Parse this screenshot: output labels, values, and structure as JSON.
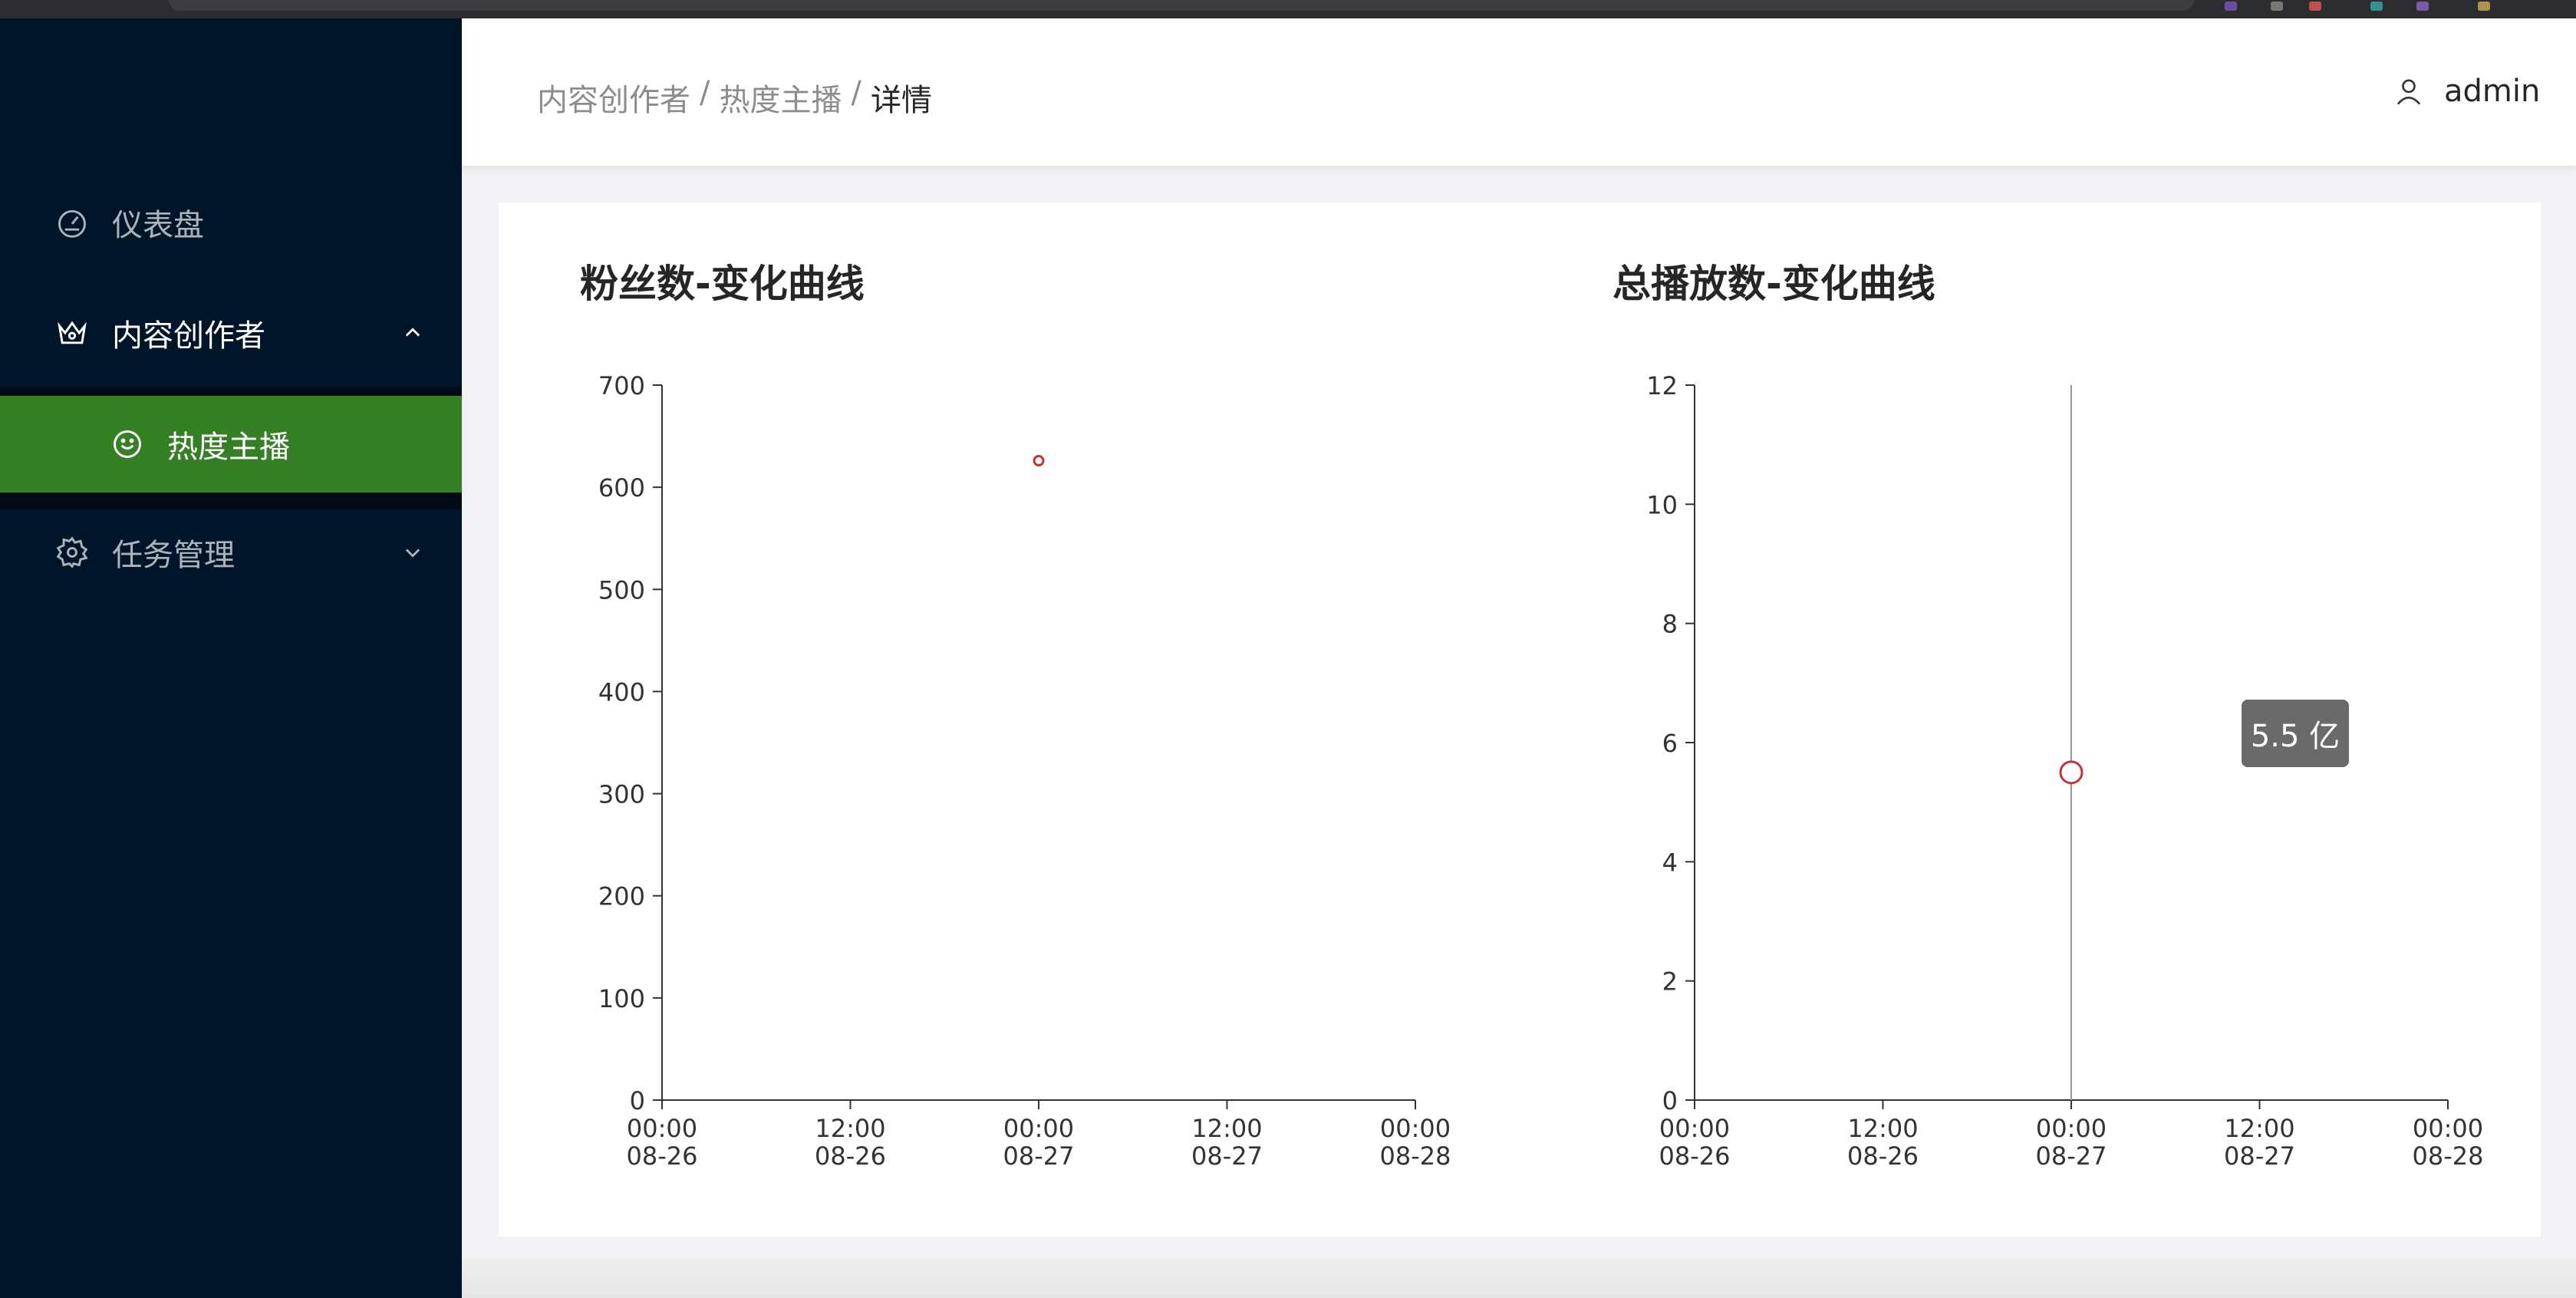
{
  "sidebar": {
    "items": [
      {
        "label": "仪表盘",
        "icon": "dashboard-icon"
      },
      {
        "label": "内容创作者",
        "icon": "crown-icon",
        "expanded": true,
        "children": [
          {
            "label": "热度主播",
            "icon": "smile-icon",
            "selected": true
          }
        ]
      },
      {
        "label": "任务管理",
        "icon": "gear-icon"
      }
    ]
  },
  "header": {
    "breadcrumb": [
      "内容创作者",
      "热度主播",
      "详情"
    ],
    "separator": "/",
    "user": "admin"
  },
  "colors": {
    "sidebar_bg": "#001529",
    "selected_bg": "#358024",
    "point": "#c23531"
  },
  "chart_data": [
    {
      "type": "scatter",
      "title": "粉丝数-变化曲线",
      "x_ticks": [
        "00:00\n08-26",
        "12:00\n08-26",
        "00:00\n08-27",
        "12:00\n08-27",
        "00:00\n08-28"
      ],
      "xlim": [
        "2023-08-26 00:00",
        "2023-08-28 00:00"
      ],
      "ylim": [
        0,
        700
      ],
      "y_ticks": [
        0,
        100,
        200,
        300,
        400,
        500,
        600,
        700
      ],
      "points": [
        {
          "x": "2023-08-27 00:00",
          "y": 626
        }
      ]
    },
    {
      "type": "scatter",
      "title": "总播放数-变化曲线",
      "x_ticks": [
        "00:00\n08-26",
        "12:00\n08-26",
        "00:00\n08-27",
        "12:00\n08-27",
        "00:00\n08-28"
      ],
      "xlim": [
        "2023-08-26 00:00",
        "2023-08-28 00:00"
      ],
      "ylim": [
        0,
        12
      ],
      "y_ticks": [
        0,
        2,
        4,
        6,
        8,
        10,
        12
      ],
      "points": [
        {
          "x": "2023-08-27 00:00",
          "y": 5.5
        }
      ],
      "tooltip": "5.5 亿"
    }
  ]
}
